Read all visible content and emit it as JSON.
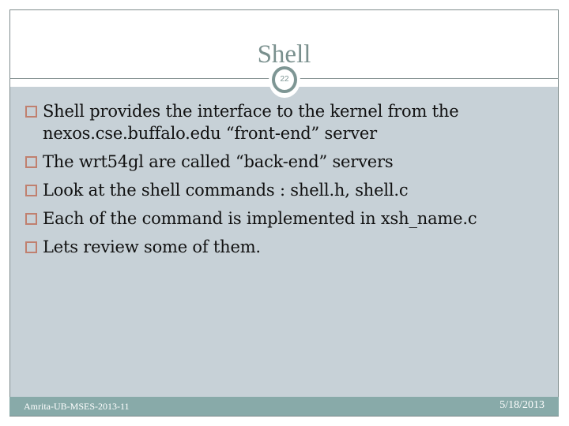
{
  "slide": {
    "title": "Shell",
    "slide_number": "22",
    "bullets": [
      {
        "text": "Shell provides the interface to the kernel from the nexos.cse.buffalo.edu “front-end” server"
      },
      {
        "text": "The wrt54gl are called “back-end” servers"
      },
      {
        "text": "Look at the shell commands : shell.h, shell.c"
      },
      {
        "text": "Each of the command is implemented in xsh_name.c"
      },
      {
        "text": "Lets review some of them."
      }
    ],
    "bullet_icon": "hollow-square-icon",
    "footer": {
      "left": "Amrita-UB-MSES-2013-11",
      "right": "5/18/2013"
    }
  },
  "colors": {
    "title": "#7a908e",
    "content_background": "#c7d1d7",
    "footer_background": "#88aaa9",
    "bullet_icon": "#c0806f",
    "frame_border": "#7f8c8d"
  }
}
